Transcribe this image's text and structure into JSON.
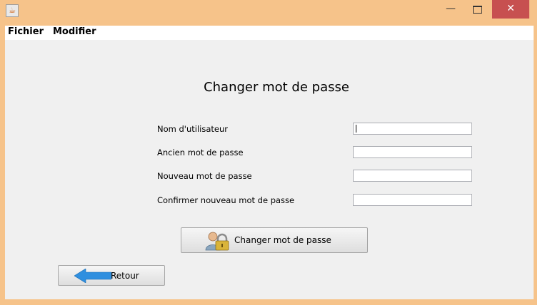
{
  "window": {
    "minimize_glyph": "—",
    "close_glyph": "✕",
    "app_icon_glyph": "☕",
    "colors": {
      "frame": "#f6c38a",
      "close": "#c75050",
      "client": "#f0f0f0"
    }
  },
  "menubar": {
    "items": [
      "Fichier",
      "Modifier"
    ]
  },
  "form": {
    "title": "Changer mot de passe",
    "fields": [
      {
        "label": "Nom d'utilisateur",
        "value": ""
      },
      {
        "label": "Ancien mot de passe",
        "value": ""
      },
      {
        "label": "Nouveau mot de passe",
        "value": ""
      },
      {
        "label": "Confirmer nouveau mot de passe",
        "value": ""
      }
    ],
    "submit_label": "Changer mot de passe",
    "submit_icon": "user-lock-icon"
  },
  "back": {
    "label": "Retour",
    "icon": "arrow-left-icon"
  }
}
